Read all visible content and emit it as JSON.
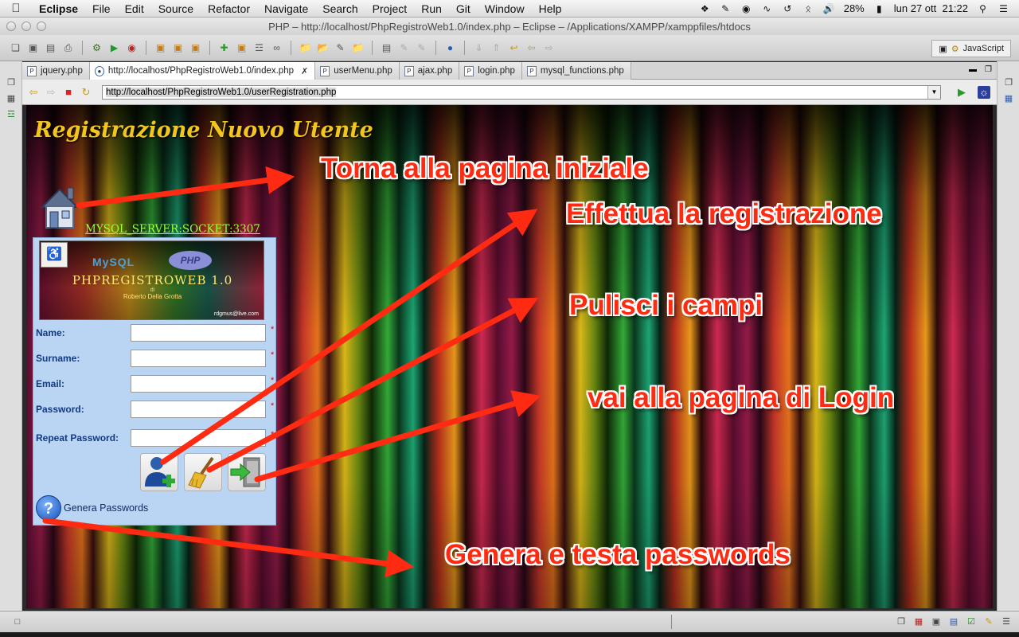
{
  "menubar": {
    "app": "Eclipse",
    "items": [
      "File",
      "Edit",
      "Source",
      "Refactor",
      "Navigate",
      "Search",
      "Project",
      "Run",
      "Git",
      "Window",
      "Help"
    ],
    "battery": "28%",
    "clock": "lun 27 ott  21:22"
  },
  "window": {
    "title": "PHP – http://localhost/PhpRegistroWeb1.0/index.php – Eclipse – /Applications/XAMPP/xamppfiles/htdocs"
  },
  "toolbar": {
    "perspective": "JavaScript"
  },
  "tabs": [
    {
      "label": "jquery.php"
    },
    {
      "label": "http://localhost/PhpRegistroWeb1.0/index.php"
    },
    {
      "label": "userMenu.php"
    },
    {
      "label": "ajax.php"
    },
    {
      "label": "login.php"
    },
    {
      "label": "mysql_functions.php"
    }
  ],
  "browser": {
    "url": "http://localhost/PhpRegistroWeb1.0/userRegistration.php"
  },
  "page": {
    "title": "Registrazione Nuovo Utente",
    "mysql_link": "MYSQL_SERVER:SOCKET:3307",
    "banner": {
      "mysql": "MySQL",
      "php": "PHP",
      "title": "PHPREGISTROWEB 1.0",
      "di": "di",
      "author": "Roberto Della Grotta",
      "email": "rdgmus@live.com"
    },
    "fields": [
      {
        "label": "Name:",
        "value": "",
        "required": "*"
      },
      {
        "label": "Surname:",
        "value": "",
        "required": "*"
      },
      {
        "label": "Email:",
        "value": "",
        "required": "*"
      },
      {
        "label": "Password:",
        "value": "",
        "required": "*"
      },
      {
        "label": "Repeat Password:",
        "value": "",
        "required": "*"
      }
    ],
    "help_label": "Genera Passwords"
  },
  "callouts": {
    "home": "Torna alla pagina iniziale",
    "register": "Effettua la registrazione",
    "clear": "Pulisci i campi",
    "login": "vai alla pagina di Login",
    "passwords": "Genera e testa passwords"
  },
  "colors": {
    "title_gold": "#f3c61e",
    "mysql_link_green": "#9cff3a",
    "callout_red": "#ff2a12",
    "form_panel_blue": "#b9d5f3"
  }
}
